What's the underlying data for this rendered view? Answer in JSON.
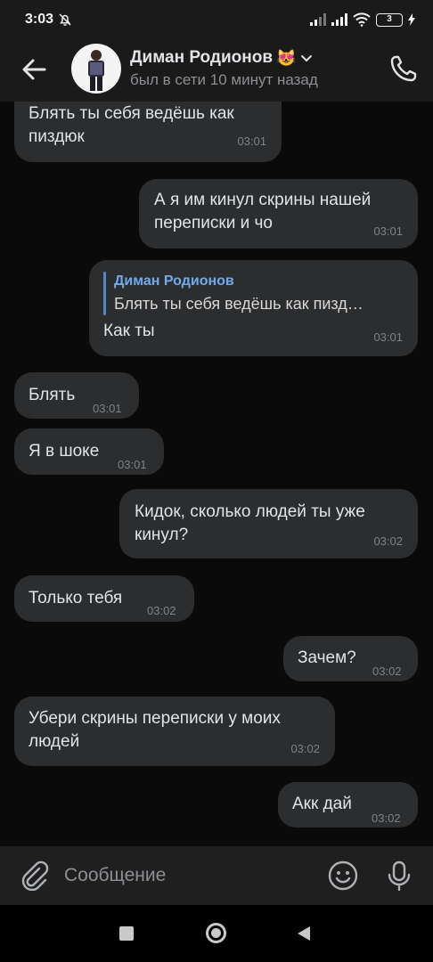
{
  "status_bar": {
    "time": "3:03",
    "battery": "3"
  },
  "header": {
    "contact_name": "Диман Родионов",
    "contact_emoji": "😻",
    "contact_status": "был в сети 10 минут назад"
  },
  "messages": [
    {
      "side": "incoming",
      "text": "Блять ты себя ведёшь как пиздюк",
      "time": "03:01"
    },
    {
      "side": "outgoing",
      "text": "А я им кинул скрины нашей переписки и чо",
      "time": "03:01"
    },
    {
      "side": "outgoing",
      "reply_to_name": "Диман Родионов",
      "reply_to_text": "Блять ты себя ведёшь как пизд…",
      "text": "Как ты",
      "time": "03:01"
    },
    {
      "side": "incoming",
      "text": "Блять",
      "time": "03:01"
    },
    {
      "side": "incoming",
      "text": "Я в шоке",
      "time": "03:01"
    },
    {
      "side": "outgoing",
      "text": "Кидок, сколько людей ты уже кинул?",
      "time": "03:02"
    },
    {
      "side": "incoming",
      "text": "Только тебя",
      "time": "03:02"
    },
    {
      "side": "outgoing",
      "text": "Зачем?",
      "time": "03:02"
    },
    {
      "side": "incoming",
      "text": "Убери скрины переписки у моих людей",
      "time": "03:02"
    },
    {
      "side": "outgoing",
      "text": "Акк дай",
      "time": "03:02"
    }
  ],
  "composer": {
    "placeholder": "Сообщение"
  },
  "icons": {
    "back": "arrow-left-icon",
    "call": "phone-icon",
    "attach": "paperclip-icon",
    "emoji": "smiley-icon",
    "mic": "microphone-icon",
    "dropdown": "chevron-down-icon"
  },
  "colors": {
    "bubble": "#2c2d2f",
    "background": "#0a0a0a",
    "bar": "#1a1a1a",
    "accent": "#71aaeb",
    "text": "#e1e3e6",
    "muted": "#8c8f94"
  }
}
